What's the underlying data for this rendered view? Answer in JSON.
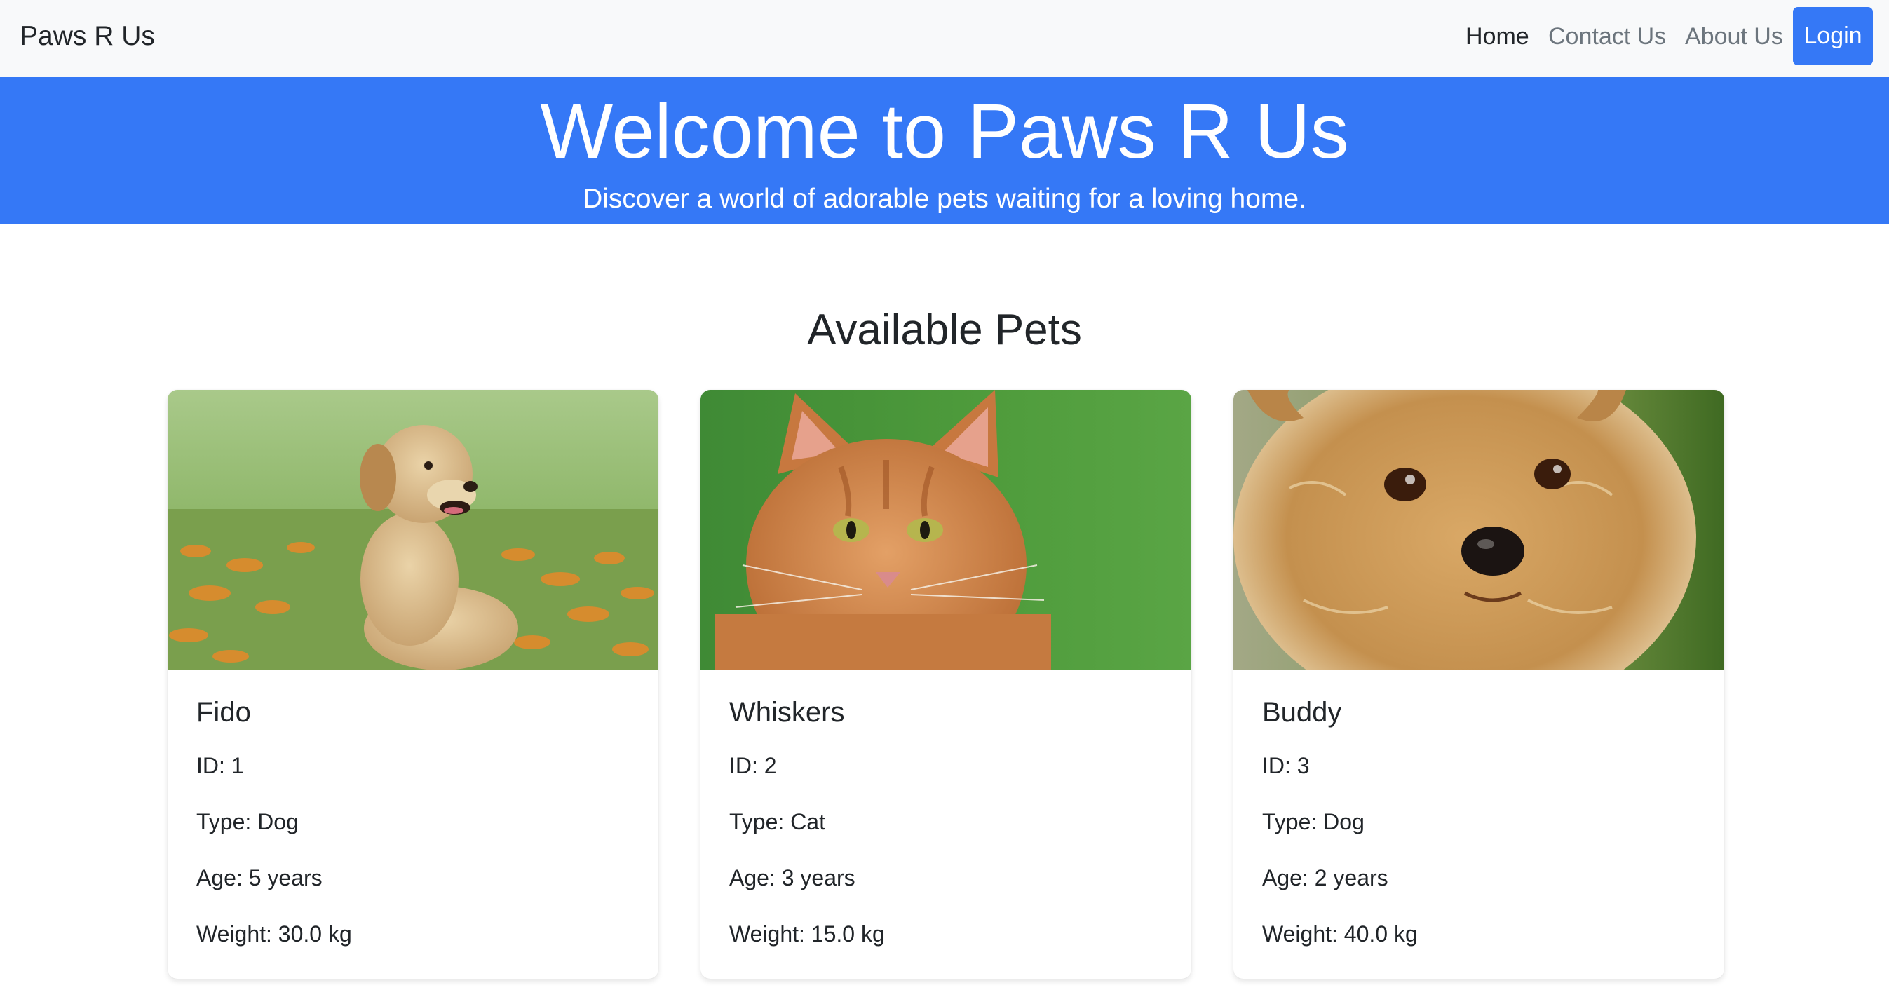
{
  "navbar": {
    "brand": "Paws R Us",
    "links": [
      {
        "label": "Home",
        "active": true
      },
      {
        "label": "Contact Us",
        "active": false
      },
      {
        "label": "About Us",
        "active": false
      }
    ],
    "login_label": "Login"
  },
  "hero": {
    "title": "Welcome to Paws R Us",
    "subtitle": "Discover a world of adorable pets waiting for a loving home."
  },
  "main": {
    "section_title": "Available Pets",
    "pets": [
      {
        "name": "Fido",
        "id": "ID: 1",
        "type": "Type: Dog",
        "age": "Age: 5 years",
        "weight": "Weight: 30.0 kg",
        "photo": "golden-retriever-puppy-photo"
      },
      {
        "name": "Whiskers",
        "id": "ID: 2",
        "type": "Type: Cat",
        "age": "Age: 3 years",
        "weight": "Weight: 15.0 kg",
        "photo": "orange-tabby-cat-photo"
      },
      {
        "name": "Buddy",
        "id": "ID: 3",
        "type": "Type: Dog",
        "age": "Age: 2 years",
        "weight": "Weight: 40.0 kg",
        "photo": "yorkshire-terrier-photo"
      }
    ]
  },
  "colors": {
    "primary": "#3578f6",
    "navbar_bg": "#f8f9fa",
    "text": "#212529",
    "muted_link": "#6c757d"
  }
}
